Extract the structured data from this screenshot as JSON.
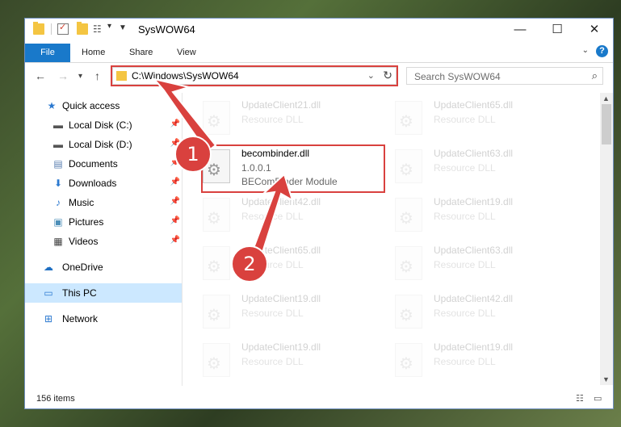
{
  "window": {
    "title": "SysWOW64",
    "minimize_glyph": "—",
    "maximize_glyph": "☐",
    "close_glyph": "✕"
  },
  "ribbon": {
    "tabs": [
      {
        "label": "File"
      },
      {
        "label": "Home"
      },
      {
        "label": "Share"
      },
      {
        "label": "View"
      }
    ],
    "help_glyph": "?"
  },
  "address": {
    "path": "C:\\Windows\\SysWOW64",
    "search_placeholder": "Search SysWOW64"
  },
  "sidebar": {
    "items": [
      {
        "label": "Quick access",
        "icon": "star-icon",
        "pinned": false
      },
      {
        "label": "Local Disk (C:)",
        "icon": "drive-icon",
        "pinned": true
      },
      {
        "label": "Local Disk (D:)",
        "icon": "drive-icon",
        "pinned": true
      },
      {
        "label": "Documents",
        "icon": "documents-icon",
        "pinned": true
      },
      {
        "label": "Downloads",
        "icon": "download-icon",
        "pinned": true
      },
      {
        "label": "Music",
        "icon": "music-icon",
        "pinned": true
      },
      {
        "label": "Pictures",
        "icon": "pictures-icon",
        "pinned": true
      },
      {
        "label": "Videos",
        "icon": "videos-icon",
        "pinned": true
      },
      {
        "label": "OneDrive",
        "icon": "cloud-icon",
        "pinned": false
      },
      {
        "label": "This PC",
        "icon": "computer-icon",
        "pinned": false,
        "selected": true
      },
      {
        "label": "Network",
        "icon": "network-icon",
        "pinned": false
      }
    ]
  },
  "files": {
    "left": [
      {
        "name": "UpdateClient21.dll",
        "type": "Resource DLL"
      },
      {
        "name": "becombinder.dll",
        "version": "1.0.0.1",
        "description": "BEComBinder Module",
        "highlighted": true
      },
      {
        "name": "UpdateClient42.dll",
        "type": "Resource DLL"
      },
      {
        "name": "UpdateClient65.dll",
        "type": "Resource DLL"
      },
      {
        "name": "UpdateClient19.dll",
        "type": "Resource DLL"
      },
      {
        "name": "UpdateClient19.dll",
        "type": "Resource DLL"
      }
    ],
    "right": [
      {
        "name": "UpdateClient65.dll",
        "type": "Resource DLL"
      },
      {
        "name": "UpdateClient63.dll",
        "type": "Resource DLL"
      },
      {
        "name": "UpdateClient19.dll",
        "type": "Resource DLL"
      },
      {
        "name": "UpdateClient63.dll",
        "type": "Resource DLL"
      },
      {
        "name": "UpdateClient42.dll",
        "type": "Resource DLL"
      },
      {
        "name": "UpdateClient19.dll",
        "type": "Resource DLL"
      }
    ]
  },
  "status": {
    "item_count": "156 items"
  },
  "annotations": {
    "step1": "1",
    "step2": "2",
    "color": "#d9413e"
  }
}
